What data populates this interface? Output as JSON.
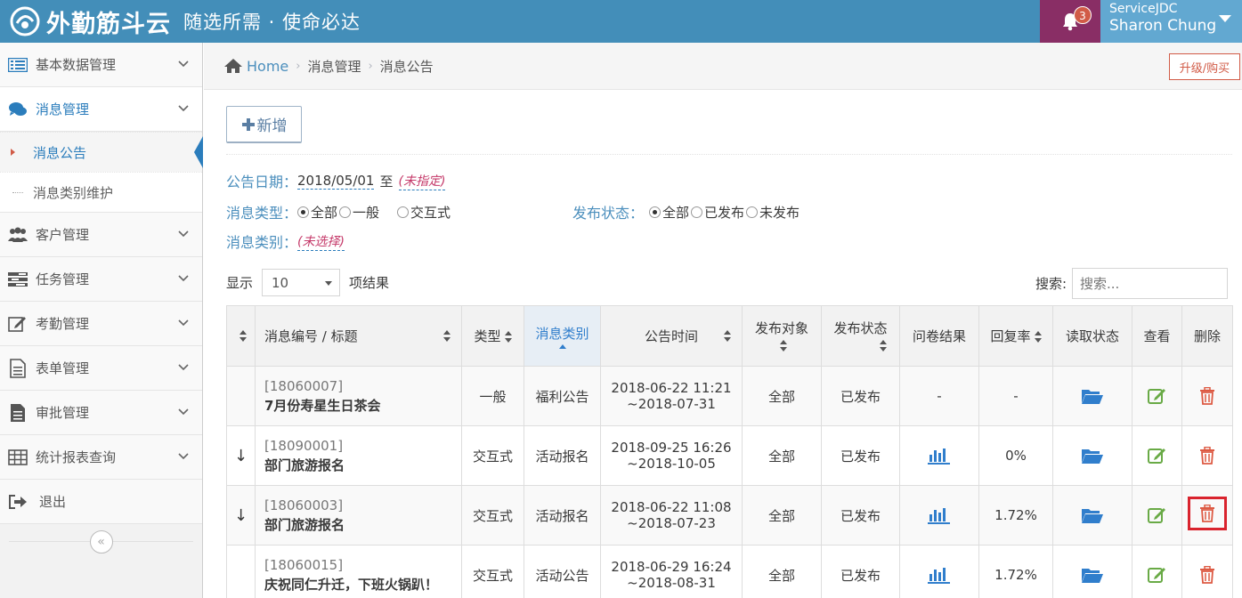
{
  "header": {
    "brand": "外勤筋斗云",
    "slogan": "随选所需 · 使命必达",
    "notification_count": "3",
    "user_company": "ServiceJDC",
    "user_name": "Sharon Chung"
  },
  "sidebar": {
    "items": [
      {
        "label": "基本数据管理",
        "icon": "list-icon"
      },
      {
        "label": "消息管理",
        "icon": "comments-icon"
      },
      {
        "label": "客户管理",
        "icon": "users-icon"
      },
      {
        "label": "任务管理",
        "icon": "tasks-icon"
      },
      {
        "label": "考勤管理",
        "icon": "edit-icon"
      },
      {
        "label": "表单管理",
        "icon": "file-icon"
      },
      {
        "label": "审批管理",
        "icon": "file-text-icon"
      },
      {
        "label": "统计报表查询",
        "icon": "table-icon"
      },
      {
        "label": "退出",
        "icon": "signout-icon"
      }
    ],
    "submenu": [
      {
        "label": "消息公告"
      },
      {
        "label": "消息类别维护"
      }
    ],
    "collapse_glyph": "«"
  },
  "breadcrumb": {
    "home": "Home",
    "level1": "消息管理",
    "level2": "消息公告",
    "upgrade": "升级/购买"
  },
  "toolbar": {
    "add_label": "新增"
  },
  "filters": {
    "date_label": "公告日期：",
    "date_from": "2018/05/01",
    "date_to_word": "至",
    "date_to": "(未指定)",
    "type_label": "消息类型：",
    "type_options": [
      "全部",
      "一般",
      "交互式"
    ],
    "status_label": "发布状态：",
    "status_options": [
      "全部",
      "已发布",
      "未发布"
    ],
    "category_label": "消息类别：",
    "category_value": "(未选择)"
  },
  "table_controls": {
    "show_label": "显示",
    "page_size": "10",
    "suffix": "项结果",
    "search_label": "搜索:",
    "search_placeholder": "搜索..."
  },
  "table": {
    "columns": [
      "消息编号 / 标题",
      "类型",
      "消息类别",
      "公告时间",
      "发布对象",
      "发布状态",
      "问卷结果",
      "回复率",
      "读取状态",
      "查看",
      "删除"
    ],
    "rows": [
      {
        "pin": "",
        "code": "[18060007]",
        "title": "7月份寿星生日茶会",
        "type": "一般",
        "category": "福利公告",
        "time1": "2018-06-22 11:21",
        "time2": "~2018-07-31",
        "target": "全部",
        "status": "已发布",
        "survey": "-",
        "reply": "-"
      },
      {
        "pin": "↓",
        "code": "[18090001]",
        "title": "部门旅游报名",
        "type": "交互式",
        "category": "活动报名",
        "time1": "2018-09-25 16:26",
        "time2": "~2018-10-05",
        "target": "全部",
        "status": "已发布",
        "survey": "chart",
        "reply": "0%"
      },
      {
        "pin": "↓",
        "code": "[18060003]",
        "title": "部门旅游报名",
        "type": "交互式",
        "category": "活动报名",
        "time1": "2018-06-22 11:08",
        "time2": "~2018-07-23",
        "target": "全部",
        "status": "已发布",
        "survey": "chart",
        "reply": "1.72%"
      },
      {
        "pin": "",
        "code": "[18060015]",
        "title": "庆祝同仁升迁，下班火锅趴！",
        "type": "交互式",
        "category": "活动公告",
        "time1": "2018-06-29 16:24",
        "time2": "~2018-08-31",
        "target": "全部",
        "status": "已发布",
        "survey": "chart",
        "reply": "1.72%"
      }
    ]
  },
  "colors": {
    "header": "#438eb9",
    "accent": "#2b7dbc",
    "view_icon": "#69aa46",
    "delete_icon": "#dd5a43",
    "highlight": "#d9232d"
  }
}
